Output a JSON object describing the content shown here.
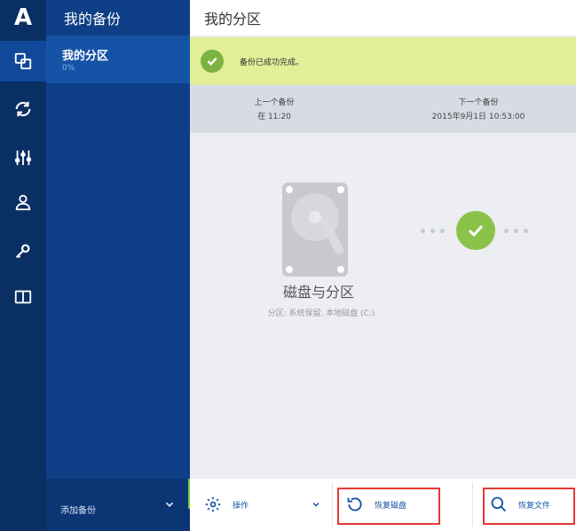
{
  "app": {
    "logo_letter": "A"
  },
  "rail": {
    "items": [
      {
        "icon": "backup-icon",
        "active": true
      },
      {
        "icon": "sync-icon"
      },
      {
        "icon": "tools-icon"
      },
      {
        "icon": "account-icon"
      },
      {
        "icon": "key-icon"
      },
      {
        "icon": "book-icon"
      }
    ]
  },
  "sidebar": {
    "title": "我的备份",
    "item": {
      "name": "我的分区",
      "sub": "0%"
    },
    "footer": {
      "add_label": "添加备份"
    }
  },
  "main": {
    "title": "我的分区",
    "banner": {
      "text": "备份已成功完成。"
    },
    "info": {
      "last_label": "上一个备份",
      "last_value": "在 11:20",
      "next_label": "下一个备份",
      "next_value": "2015年9月1日 10:53:00"
    },
    "source": {
      "name": "磁盘与分区",
      "sub": "分区: 系统保留, 本地磁盘 (C:)"
    }
  },
  "toolbar": {
    "operate_label": "操作",
    "recover_disk_label": "恢复磁盘",
    "recover_files_label": "恢复文件"
  },
  "colors": {
    "rail_bg": "#0a2f63",
    "sidebar_bg": "#0e3f86",
    "banner_bg": "#e3ee99",
    "success_green": "#8bc34a",
    "highlight_red": "#e53935",
    "accent_blue": "#1553a6"
  }
}
